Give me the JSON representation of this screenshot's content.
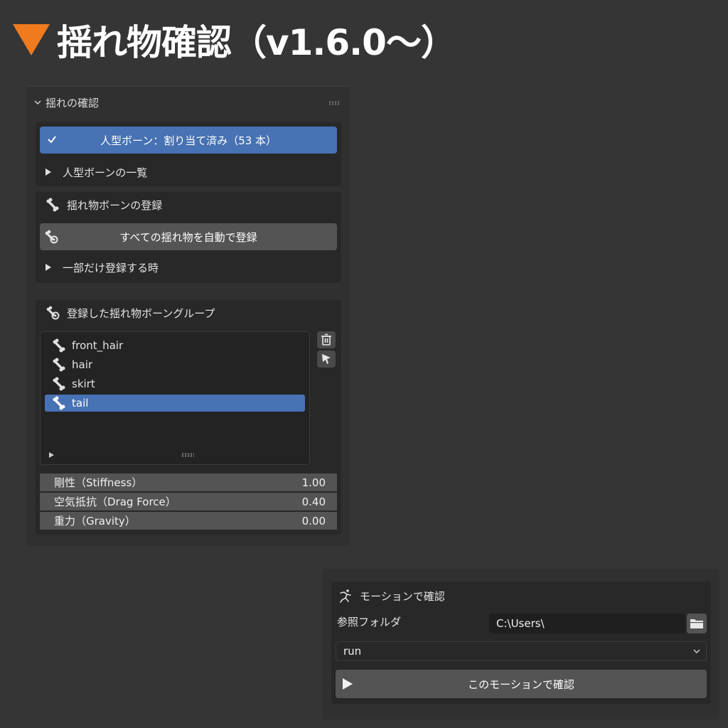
{
  "heading": {
    "title": "揺れ物確認（v1.6.0～）",
    "marker_color": "#f07b1e"
  },
  "colors": {
    "accent": "#4772b3",
    "button": "#545454",
    "panel": "#303030",
    "box": "#282828"
  },
  "panel": {
    "title": "揺れの確認",
    "humanoid": {
      "status_label": "人型ボーン：割り当て済み（53 本）",
      "list_toggle": "人型ボーンの一覧"
    },
    "register": {
      "title": "揺れ物ボーンの登録",
      "auto_button": "すべての揺れ物を自動で登録",
      "partial_toggle": "一部だけ登録する時"
    },
    "groups": {
      "title": "登録した揺れ物ボーングループ",
      "items": [
        {
          "label": "front_hair",
          "selected": false
        },
        {
          "label": "hair",
          "selected": false
        },
        {
          "label": "skirt",
          "selected": false
        },
        {
          "label": "tail",
          "selected": true
        }
      ],
      "properties": [
        {
          "label": "剛性（Stiffness）",
          "value": "1.00"
        },
        {
          "label": "空気抵抗（Drag Force）",
          "value": "0.40"
        },
        {
          "label": "重力（Gravity）",
          "value": "0.00"
        }
      ]
    }
  },
  "motion": {
    "title": "モーションで確認",
    "folder_label": "参照フォルダ",
    "folder_value": "C:\\Users\\",
    "motion_select": "run",
    "confirm_button": "このモーションで確認"
  }
}
